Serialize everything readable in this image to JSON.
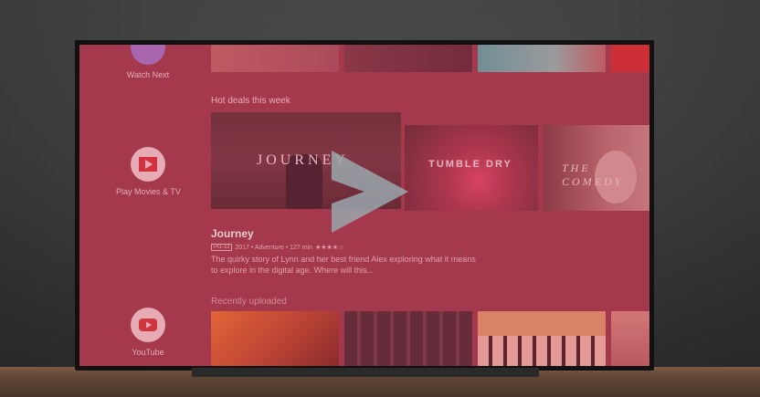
{
  "sidebar": {
    "apps": [
      {
        "label": "Watch Next",
        "icon": "watch-next-icon"
      },
      {
        "label": "Play Movies & TV",
        "icon": "play-movies-icon"
      },
      {
        "label": "YouTube",
        "icon": "youtube-icon"
      }
    ]
  },
  "rows": {
    "hot_deals": {
      "title": "Hot deals this week",
      "tiles": [
        {
          "text": "JOURNEY"
        },
        {
          "text": "TUMBLE DRY"
        },
        {
          "text": "THE COMEDY"
        }
      ]
    },
    "recently_uploaded": {
      "title": "Recently uploaded"
    }
  },
  "featured": {
    "title": "Journey",
    "rating": "PG-13",
    "meta": "2017 • Adventure • 127 min",
    "stars": "★★★★☆",
    "description": "The quirky story of Lynn and her best friend Alex exploring what it means to explore in the digital age. Where will this..."
  },
  "colors": {
    "overlay": "#be2d46",
    "screen": "#9b3c4f",
    "accent": "#d33a3a"
  }
}
